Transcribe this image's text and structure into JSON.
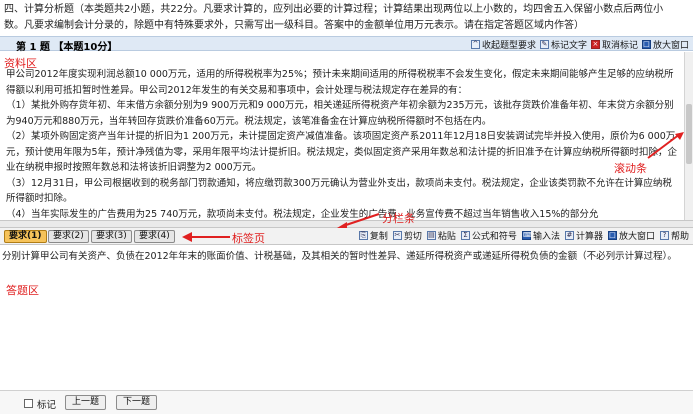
{
  "instructions": {
    "line1": "四、计算分析题（本类题共2小题，共22分。凡要求计算的，应列出必要的计算过程；计算结果出现两位以上小数的，均四舍五入保留小数点后两位小",
    "line2": "数。凡要求编制会计分录的，除题中有特殊要求外，只需写出一级科目。答案中的金额单位用万元表示。请在指定答题区域内作答）"
  },
  "question_bar": {
    "title": "第 1 题 【本题10分】",
    "tools": [
      "收起题型要求",
      "标记文字",
      "取消标记",
      "放大窗口"
    ]
  },
  "material": {
    "label": "资料区",
    "paragraphs": [
      "甲公司2012年度实现利润总额10 000万元，适用的所得税税率为25%；预计未来期间适用的所得税税率不会发生变化，假定未来期间能够产生足够的应纳税所得额以利用可抵扣暂时性差异。甲公司2012年发生的有关交易和事项中，会计处理与税法规定存在差异的有：",
      "（1）某批外购存货年初、年末借方余额分别为9 900万元和9 000万元，相关递延所得税资产年初余额为235万元，该批存货跌价准备年初、年末贷方余额分别为940万元和880万元，当年转回存货跌价准备60万元。税法规定，该笔准备金在计算应纳税所得额时不包括在内。",
      "（2）某项外购固定资产当年计提的折旧为1 200万元，未计提固定资产减值准备。该项固定资产系2011年12月18日安装调试完毕并投入使用，原价为6 000万元，预计使用年限为5年，预计净残值为零，采用年限平均法计提折旧。税法规定，类似固定资产采用年数总和法计提的折旧准予在计算应纳税所得额时扣除，企业在纳税申报时按照年数总和法将该折旧调整为2 000万元。",
      "（3）12月31日，甲公司根据收到的税务部门罚款通知，将应缴罚款300万元确认为营业外支出，款项尚未支付。税法规定，企业该类罚款不允许在计算应纳税所得额时扣除。",
      "（4）当年实际发生的广告费用为25 740万元，款项尚未支付。税法规定，企业发生的广告费、业务宣传费不超过当年销售收入15%的部分允"
    ]
  },
  "annotations": {
    "scrollbar": "滚动条",
    "splitter": "分栏条",
    "tabs": "标签页",
    "answer_area": "答题区"
  },
  "tabs": [
    "要求(1)",
    "要求(2)",
    "要求(3)",
    "要求(4)"
  ],
  "answer_tools": [
    "复制",
    "剪切",
    "粘贴",
    "公式和符号",
    "输入法",
    "计算器",
    "放大窗口",
    "帮助"
  ],
  "prompt": "分别计算甲公司有关资产、负债在2012年年末的账面价值、计税基础，及其相关的暂时性差异、递延所得税资产或递延所得税负债的金额（不必列示计算过程）。",
  "bottom": {
    "mark": "标记",
    "prev": "上一题",
    "next": "下一题"
  }
}
